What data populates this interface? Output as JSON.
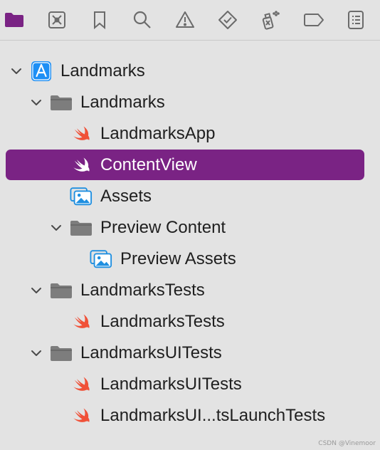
{
  "toolbar": {
    "buttons": [
      {
        "name": "project-navigator-button",
        "icon": "folder-icon"
      },
      {
        "name": "source-control-button",
        "icon": "source-control-icon"
      },
      {
        "name": "bookmarks-button",
        "icon": "bookmark-icon"
      },
      {
        "name": "find-button",
        "icon": "search-icon"
      },
      {
        "name": "issues-button",
        "icon": "warning-icon"
      },
      {
        "name": "tests-button",
        "icon": "test-diamond-icon"
      },
      {
        "name": "debug-button",
        "icon": "spray-can-icon"
      },
      {
        "name": "breakpoints-button",
        "icon": "breakpoint-tag-icon"
      },
      {
        "name": "reports-button",
        "icon": "report-list-icon"
      }
    ],
    "active_color": "#7a2384"
  },
  "tree": {
    "items": [
      {
        "label": "Landmarks",
        "icon": "xcode-project-icon",
        "expanded": true,
        "selected": false
      },
      {
        "label": "Landmarks",
        "icon": "folder-icon",
        "expanded": true,
        "selected": false
      },
      {
        "label": "LandmarksApp",
        "icon": "swift-icon",
        "selected": false
      },
      {
        "label": "ContentView",
        "icon": "swift-icon",
        "selected": true
      },
      {
        "label": "Assets",
        "icon": "asset-catalog-icon",
        "selected": false
      },
      {
        "label": "Preview Content",
        "icon": "folder-icon",
        "expanded": true,
        "selected": false
      },
      {
        "label": "Preview Assets",
        "icon": "asset-catalog-icon",
        "selected": false
      },
      {
        "label": "LandmarksTests",
        "icon": "folder-icon",
        "expanded": true,
        "selected": false
      },
      {
        "label": "LandmarksTests",
        "icon": "swift-icon",
        "selected": false
      },
      {
        "label": "LandmarksUITests",
        "icon": "folder-icon",
        "expanded": true,
        "selected": false
      },
      {
        "label": "LandmarksUITests",
        "icon": "swift-icon",
        "selected": false
      },
      {
        "label": "LandmarksUI...tsLaunchTests",
        "icon": "swift-icon",
        "selected": false
      }
    ],
    "selection_color": "#7a2384"
  },
  "watermark": "CSDN @Vinemoor"
}
